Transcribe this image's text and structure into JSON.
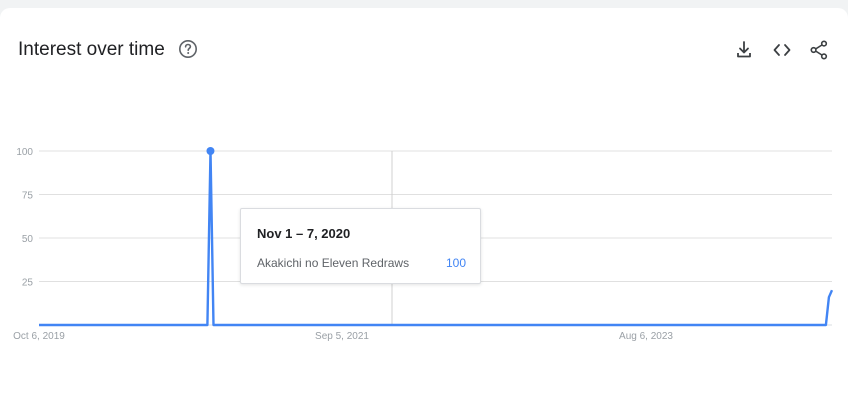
{
  "header": {
    "title": "Interest over time",
    "icons": {
      "help": "help-circle-icon",
      "download": "download-icon",
      "embed": "code-icon",
      "share": "share-icon"
    }
  },
  "colors": {
    "series": "#4285f4",
    "grid": "#e0e0e0",
    "tick_label": "#9aa0a6",
    "text": "#202124"
  },
  "chart_data": {
    "type": "line",
    "y_ticks": [
      100,
      75,
      50,
      25
    ],
    "ylim": [
      0,
      100
    ],
    "x_ticks": [
      "Oct 6, 2019",
      "Sep 5, 2021",
      "Aug 6, 2023"
    ],
    "series": [
      {
        "name": "Akakichi no Eleven Redraws",
        "points": [
          {
            "x": "2019-10-06",
            "y": 0
          },
          {
            "x": "2020-10-25",
            "y": 0
          },
          {
            "x": "2020-11-01",
            "y": 100
          },
          {
            "x": "2020-11-08",
            "y": 0
          },
          {
            "x": "2024-09-08",
            "y": 0
          },
          {
            "x": "2024-09-15",
            "y": 16
          },
          {
            "x": "2024-09-22",
            "y": 20
          }
        ]
      }
    ]
  },
  "tooltip": {
    "date": "Nov 1 – 7, 2020",
    "term": "Akakichi no Eleven Redraws",
    "value": "100"
  }
}
